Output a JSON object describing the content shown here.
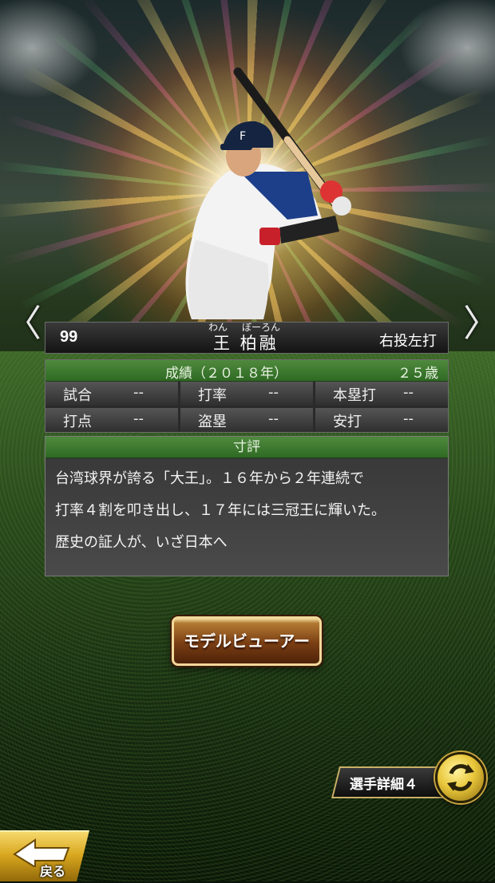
{
  "player": {
    "number": "99",
    "name": "王 柏融",
    "name_ruby_1": "わん",
    "name_ruby_2": "ぼーろん",
    "throw_bat": "右投左打"
  },
  "stats": {
    "title": "成績（２０１８年）",
    "age": "２５歳",
    "rows": [
      [
        {
          "label": "試合",
          "value": "--"
        },
        {
          "label": "打率",
          "value": "--"
        },
        {
          "label": "本塁打",
          "value": "--"
        }
      ],
      [
        {
          "label": "打点",
          "value": "--"
        },
        {
          "label": "盗塁",
          "value": "--"
        },
        {
          "label": "安打",
          "value": "--"
        }
      ]
    ]
  },
  "comment": {
    "title": "寸評",
    "lines": [
      "台湾球界が誇る「大王」。１６年から２年連続で",
      "打率４割を叩き出し、１７年には三冠王に輝いた。",
      "歴史の証人が、いざ日本へ"
    ]
  },
  "buttons": {
    "model_viewer": "モデルビューアー",
    "player_detail": "選手詳細４",
    "back": "戻る"
  },
  "nav": {
    "prev": "〈",
    "next": "〉"
  },
  "icons": {
    "prev": "chevron-left-icon",
    "next": "chevron-right-icon",
    "swap": "swap-arrows-icon",
    "back": "back-arrow-icon"
  }
}
